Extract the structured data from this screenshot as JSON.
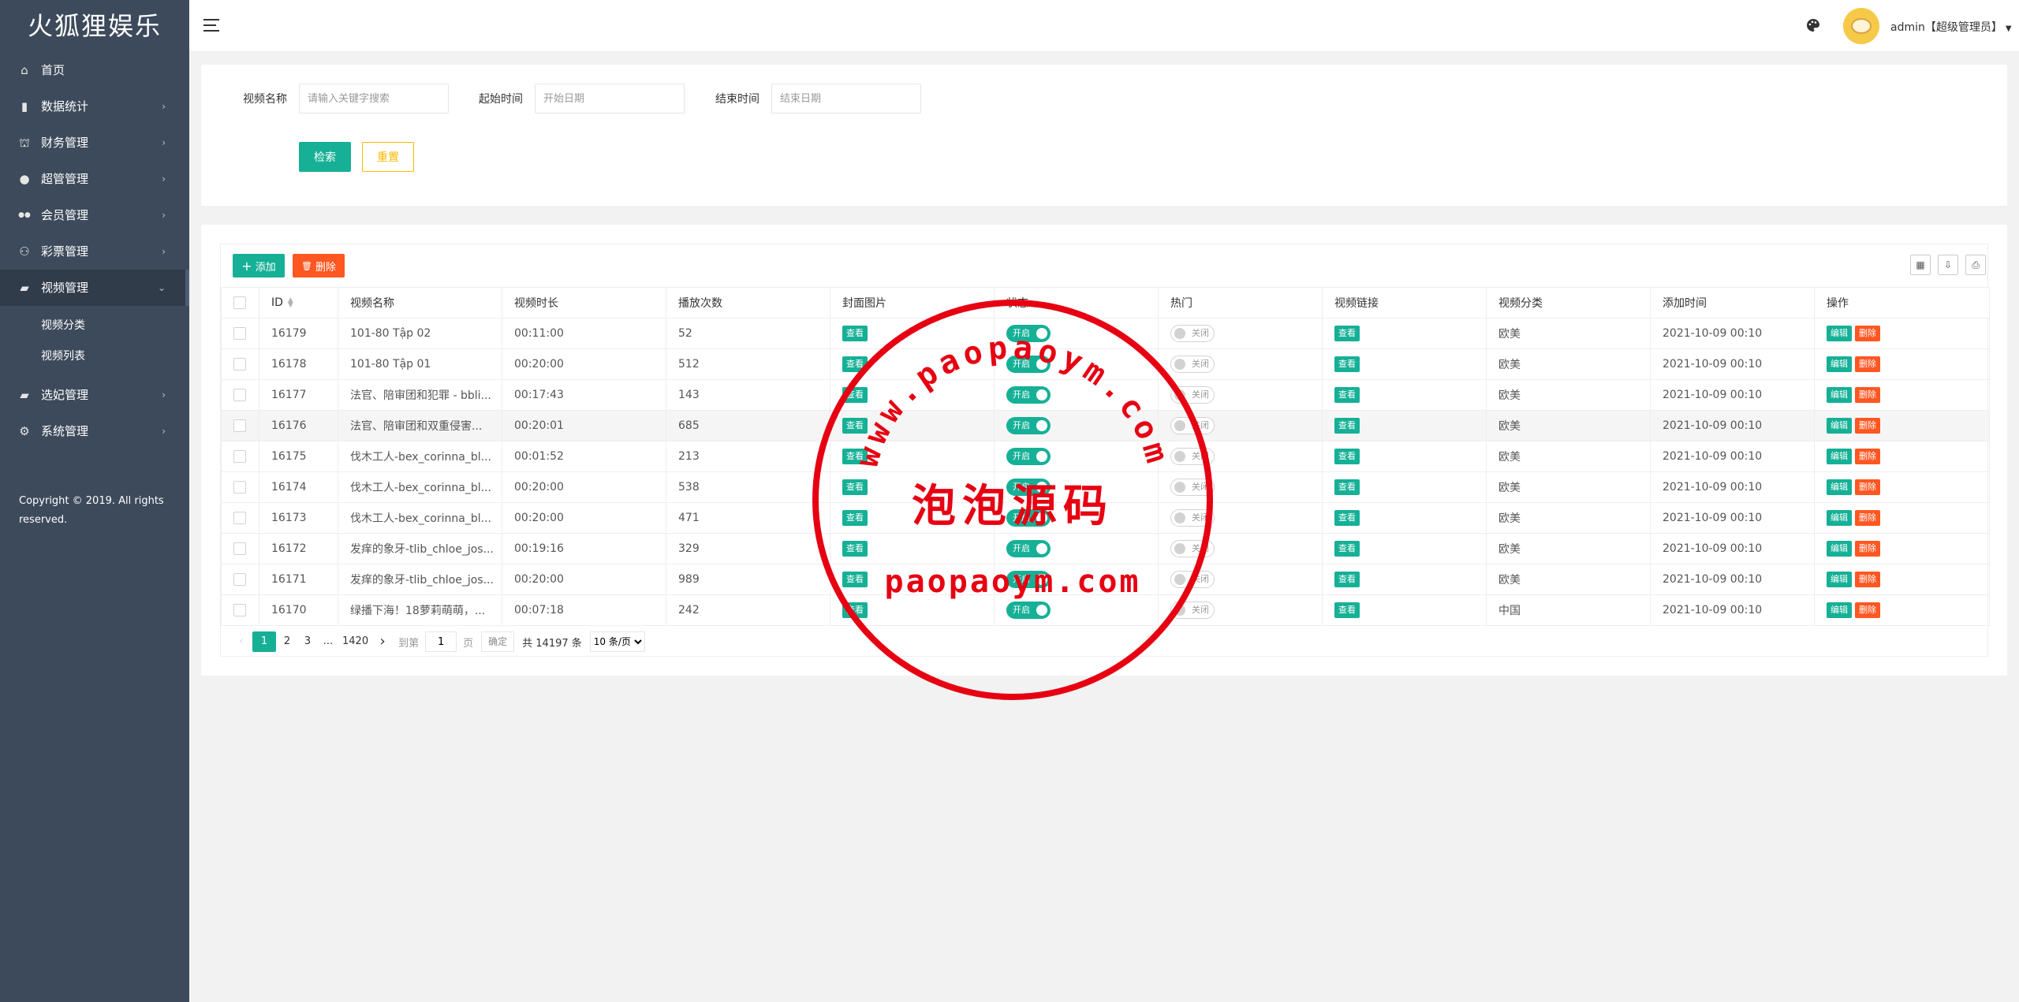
{
  "app": {
    "title": "火狐狸娱乐"
  },
  "sidebar": {
    "items": [
      {
        "label": "首页",
        "icon": "home-icon",
        "has_children": false
      },
      {
        "label": "数据统计",
        "icon": "bar-chart-icon",
        "has_children": true
      },
      {
        "label": "财务管理",
        "icon": "bank-icon",
        "has_children": true
      },
      {
        "label": "超管管理",
        "icon": "user-icon",
        "has_children": true
      },
      {
        "label": "会员管理",
        "icon": "users-icon",
        "has_children": true
      },
      {
        "label": "彩票管理",
        "icon": "gamepad-icon",
        "has_children": true
      },
      {
        "label": "视频管理",
        "icon": "video-icon",
        "has_children": true,
        "open": true,
        "children": [
          {
            "label": "视频分类"
          },
          {
            "label": "视频列表"
          }
        ]
      },
      {
        "label": "选妃管理",
        "icon": "video-icon",
        "has_children": true
      },
      {
        "label": "系统管理",
        "icon": "gear-icon",
        "has_children": true
      }
    ],
    "copyright": "Copyright © 2019. All rights reserved."
  },
  "header": {
    "user": "admin【超级管理员】"
  },
  "search": {
    "name_label": "视频名称",
    "name_placeholder": "请输入关键字搜索",
    "start_label": "起始时间",
    "start_placeholder": "开始日期",
    "end_label": "结束时间",
    "end_placeholder": "结束日期",
    "search_btn": "检索",
    "reset_btn": "重置"
  },
  "toolbar": {
    "add_label": "添加",
    "delete_label": "删除"
  },
  "table": {
    "columns": [
      "ID",
      "视频名称",
      "视频时长",
      "播放次数",
      "封面图片",
      "状态",
      "热门",
      "视频链接",
      "视频分类",
      "添加时间",
      "操作"
    ],
    "view_label": "查看",
    "on_label": "开启",
    "off_label": "关闭",
    "edit_label": "编辑",
    "del_label": "删除",
    "rows": [
      {
        "id": "16179",
        "name": "101-80 Tập 02",
        "duration": "00:11:00",
        "plays": "52",
        "status": true,
        "hot": false,
        "category": "欧美",
        "time": "2021-10-09 00:10"
      },
      {
        "id": "16178",
        "name": "101-80 Tập 01",
        "duration": "00:20:00",
        "plays": "512",
        "status": true,
        "hot": false,
        "category": "欧美",
        "time": "2021-10-09 00:10"
      },
      {
        "id": "16177",
        "name": "法官、陪审团和犯罪 - bbli...",
        "duration": "00:17:43",
        "plays": "143",
        "status": true,
        "hot": false,
        "category": "欧美",
        "time": "2021-10-09 00:10"
      },
      {
        "id": "16176",
        "name": "法官、陪审团和双重侵害...",
        "duration": "00:20:01",
        "plays": "685",
        "status": true,
        "hot": false,
        "category": "欧美",
        "time": "2021-10-09 00:10"
      },
      {
        "id": "16175",
        "name": "伐木工人-bex_corinna_bl...",
        "duration": "00:01:52",
        "plays": "213",
        "status": true,
        "hot": false,
        "category": "欧美",
        "time": "2021-10-09 00:10"
      },
      {
        "id": "16174",
        "name": "伐木工人-bex_corinna_bl...",
        "duration": "00:20:00",
        "plays": "538",
        "status": true,
        "hot": false,
        "category": "欧美",
        "time": "2021-10-09 00:10"
      },
      {
        "id": "16173",
        "name": "伐木工人-bex_corinna_bl...",
        "duration": "00:20:00",
        "plays": "471",
        "status": true,
        "hot": false,
        "category": "欧美",
        "time": "2021-10-09 00:10"
      },
      {
        "id": "16172",
        "name": "发痒的象牙-tlib_chloe_jos...",
        "duration": "00:19:16",
        "plays": "329",
        "status": true,
        "hot": false,
        "category": "欧美",
        "time": "2021-10-09 00:10"
      },
      {
        "id": "16171",
        "name": "发痒的象牙-tlib_chloe_jos...",
        "duration": "00:20:00",
        "plays": "989",
        "status": true,
        "hot": false,
        "category": "欧美",
        "time": "2021-10-09 00:10"
      },
      {
        "id": "16170",
        "name": "绿播下海！18萝莉萌萌，...",
        "duration": "00:07:18",
        "plays": "242",
        "status": true,
        "hot": false,
        "category": "中国",
        "time": "2021-10-09 00:10"
      }
    ]
  },
  "pager": {
    "pages": [
      "1",
      "2",
      "3"
    ],
    "ellipsis": "...",
    "last": "1420",
    "goto_label": "到第",
    "goto_value": "1",
    "page_unit": "页",
    "ok_label": "确定",
    "total": "共 14197 条",
    "per_page": "10 条/页"
  },
  "watermark": {
    "arc_text": "www.paopaoym.com",
    "center_text": "泡泡源码",
    "bottom_text": "paopaoym.com",
    "color": "#e60012"
  },
  "colors": {
    "primary": "#16b096",
    "danger": "#ff5722",
    "warning": "#ffb800",
    "sidebar": "#3d4a5b"
  }
}
